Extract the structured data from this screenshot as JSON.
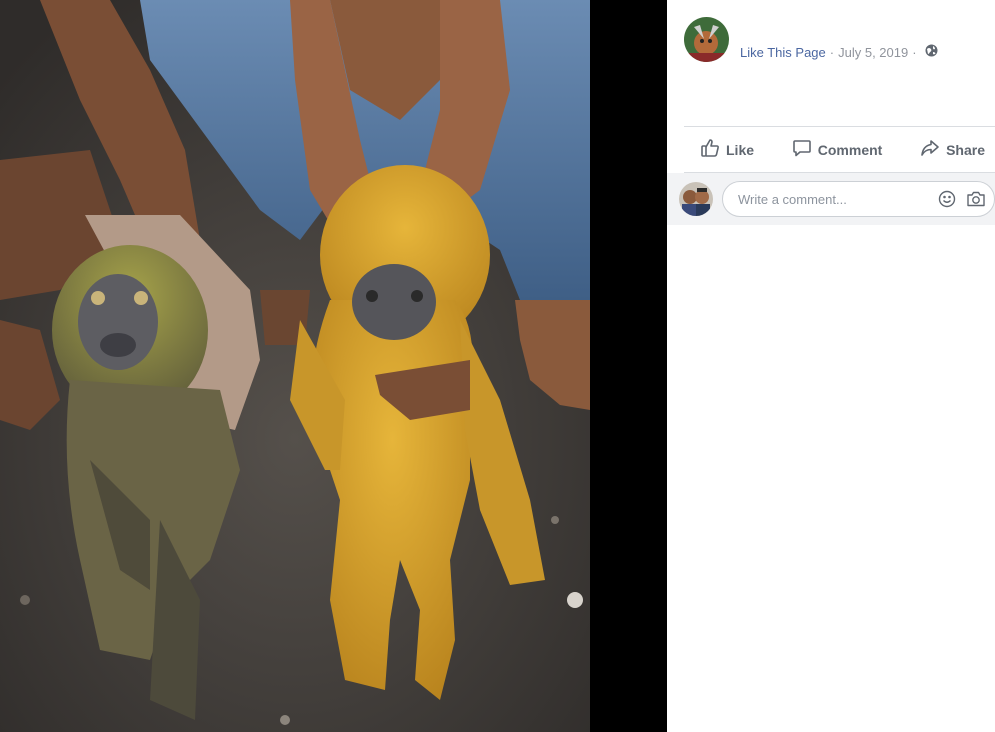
{
  "post": {
    "page_name": "Like This Page",
    "separator": "·",
    "date": "July 5, 2019",
    "privacy_icon": "globe-icon"
  },
  "actions": {
    "like_label": "Like",
    "comment_label": "Comment",
    "share_label": "Share"
  },
  "comment_box": {
    "placeholder": "Write a comment...",
    "emoji_icon": "smiley-icon",
    "camera_icon": "camera-icon"
  },
  "colors": {
    "link": "#4b67a1",
    "meta": "#90949c",
    "action_text": "#606770",
    "comment_bg": "#f2f3f5"
  }
}
